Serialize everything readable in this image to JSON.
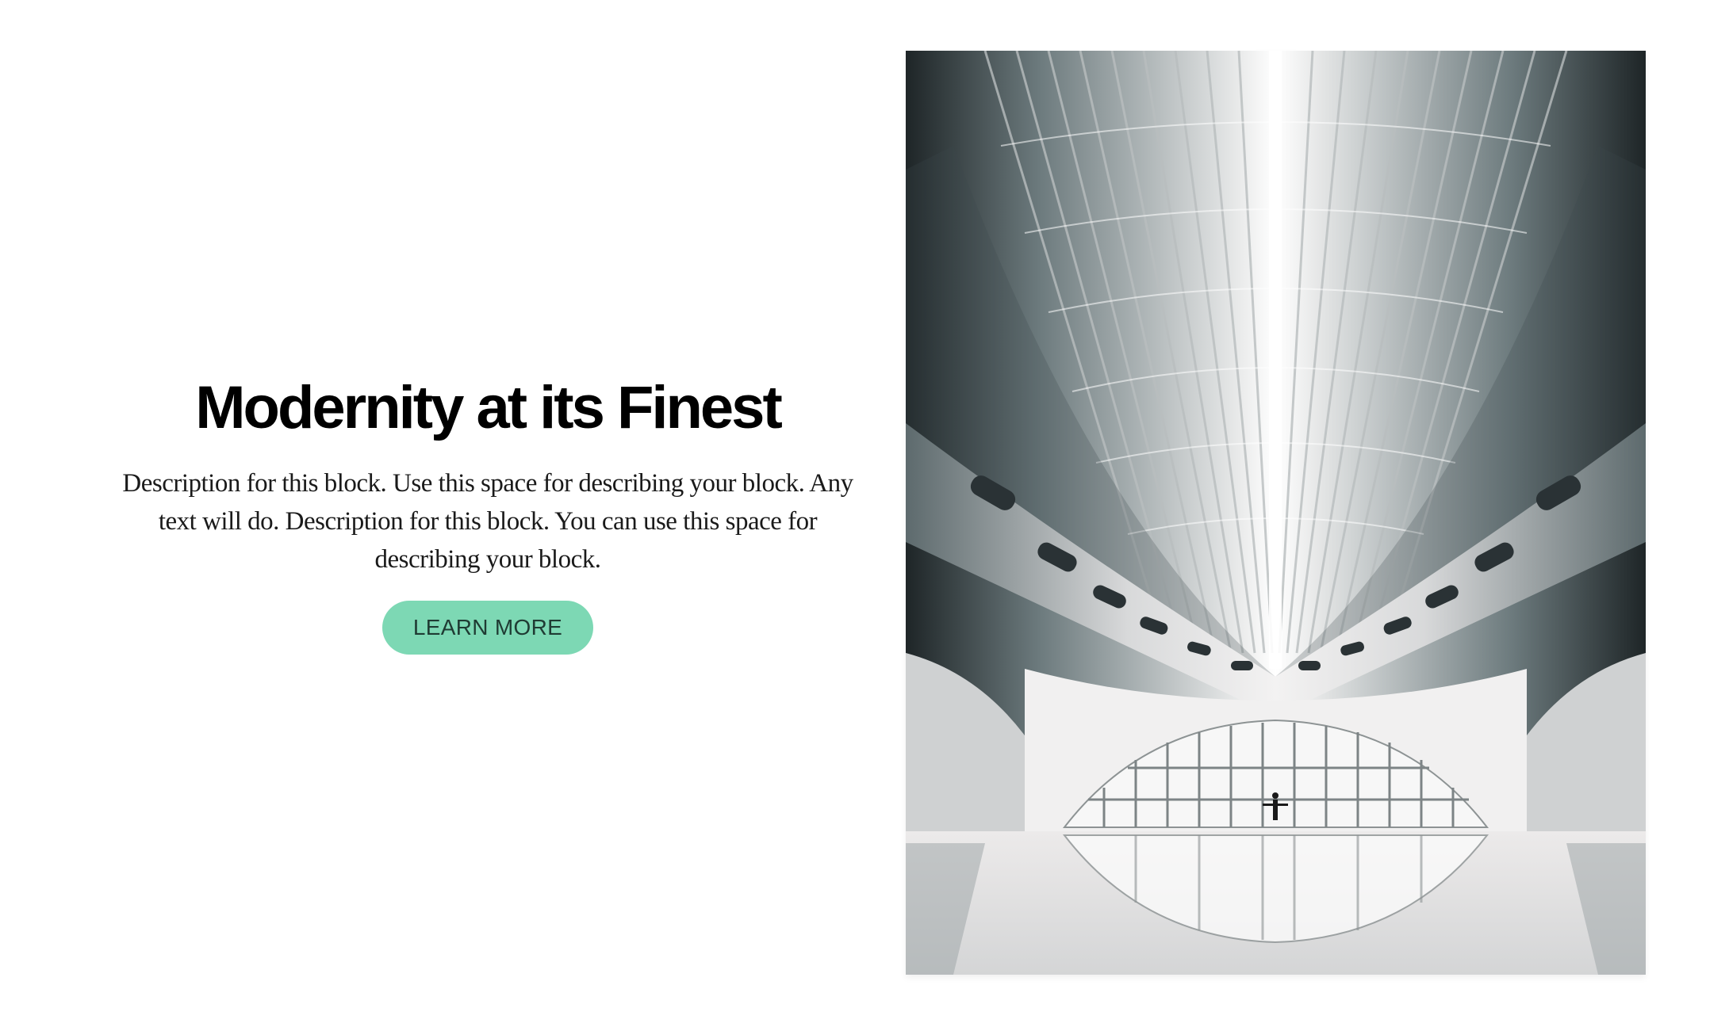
{
  "hero": {
    "title": "Modernity at its Finest",
    "description": "Description for this block. Use this space for describing your block. Any text will do. Description for this block. You can use this space for describing your block.",
    "button_label": "LEARN MORE"
  },
  "image": {
    "subject": "architecture-photo"
  },
  "colors": {
    "accent": "#7dd8b4",
    "button_text": "#1f3b33",
    "background": "#ffffff",
    "title": "#000000"
  }
}
